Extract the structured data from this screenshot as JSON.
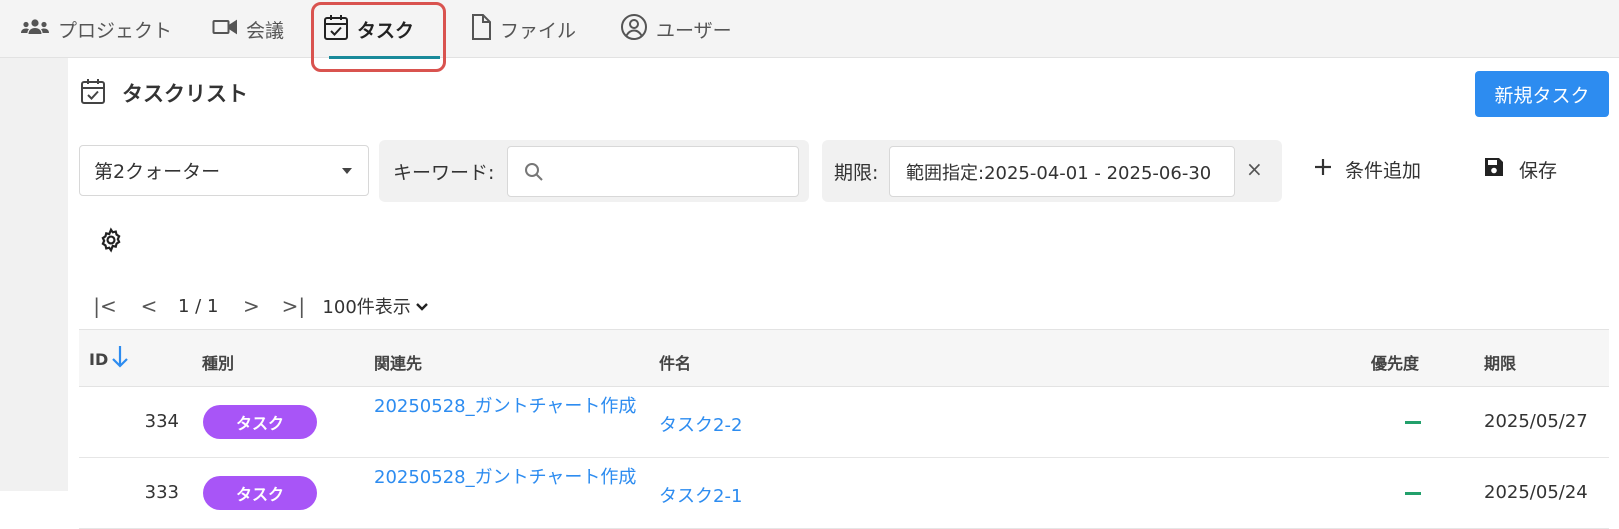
{
  "nav": {
    "items": [
      {
        "label": "プロジェクト",
        "icon": "users-icon"
      },
      {
        "label": "会議",
        "icon": "video-camera-icon"
      },
      {
        "label": "タスク",
        "icon": "calendar-check-icon",
        "active": true
      },
      {
        "label": "ファイル",
        "icon": "file-icon"
      },
      {
        "label": "ユーザー",
        "icon": "user-circle-icon"
      }
    ],
    "active_frame_color": "#d9534f",
    "active_underline_color": "#1a8a9a"
  },
  "header": {
    "title": "タスクリスト",
    "new_task_label": "新規タスク",
    "new_task_color": "#2d8cf0"
  },
  "filters": {
    "quarter": "第2クォーター",
    "keyword_label": "キーワード:",
    "keyword_value": "",
    "keyword_placeholder": "",
    "due_label": "期限:",
    "due_value": "範囲指定:2025-04-01 - 2025-06-30",
    "due_clear": "×",
    "add_condition_label": "条件追加",
    "save_label": "保存"
  },
  "pagination": {
    "first": "|<",
    "prev": "<",
    "info": "1 / 1",
    "next": ">",
    "last": ">|",
    "page_size": "100件表示"
  },
  "table": {
    "columns": [
      "ID",
      "種別",
      "関連先",
      "件名",
      "優先度",
      "期限"
    ],
    "sort_column": "ID",
    "sort_direction": "desc",
    "rows": [
      {
        "id": "334",
        "type": "タスク",
        "related": "20250528_ガントチャート作成",
        "subject": "タスク2-2",
        "priority": "—",
        "due": "2025/05/27"
      },
      {
        "id": "333",
        "type": "タスク",
        "related": "20250528_ガントチャート作成",
        "subject": "タスク2-1",
        "priority": "—",
        "due": "2025/05/24"
      }
    ],
    "badge_color": "#a855f7",
    "link_color": "#2d8cf0",
    "priority_color": "#22a06b"
  }
}
